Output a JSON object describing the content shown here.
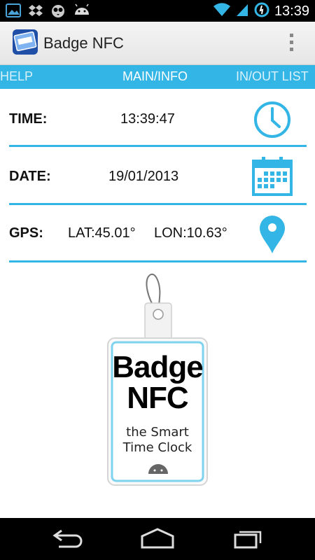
{
  "status_bar": {
    "time": "13:39",
    "left_icons": [
      "gallery-icon",
      "dropbox-icon",
      "owl-icon",
      "android-icon"
    ],
    "right_icons": [
      "wifi-icon",
      "signal-icon",
      "sync-icon"
    ]
  },
  "action_bar": {
    "title": "Badge NFC",
    "overflow_icon": "overflow-menu-icon"
  },
  "tabs": [
    {
      "label": "HELP",
      "selected": false
    },
    {
      "label": "MAIN/INFO",
      "selected": true
    },
    {
      "label": "IN/OUT LIST",
      "selected": false
    }
  ],
  "info": {
    "time": {
      "label": "TIME:",
      "value": "13:39:47",
      "icon": "clock-icon"
    },
    "date": {
      "label": "DATE:",
      "value": "19/01/2013",
      "icon": "calendar-icon"
    },
    "gps": {
      "label": "GPS:",
      "lat": "LAT:45.01°",
      "lon": "LON:10.63°",
      "icon": "map-pin-icon"
    }
  },
  "badge": {
    "line1": "Badge",
    "line2": "NFC",
    "line3": "the Smart",
    "line4": "Time Clock"
  },
  "colors": {
    "accent": "#33b5e5",
    "status_bar": "#000000",
    "nav_bar": "#000000"
  }
}
